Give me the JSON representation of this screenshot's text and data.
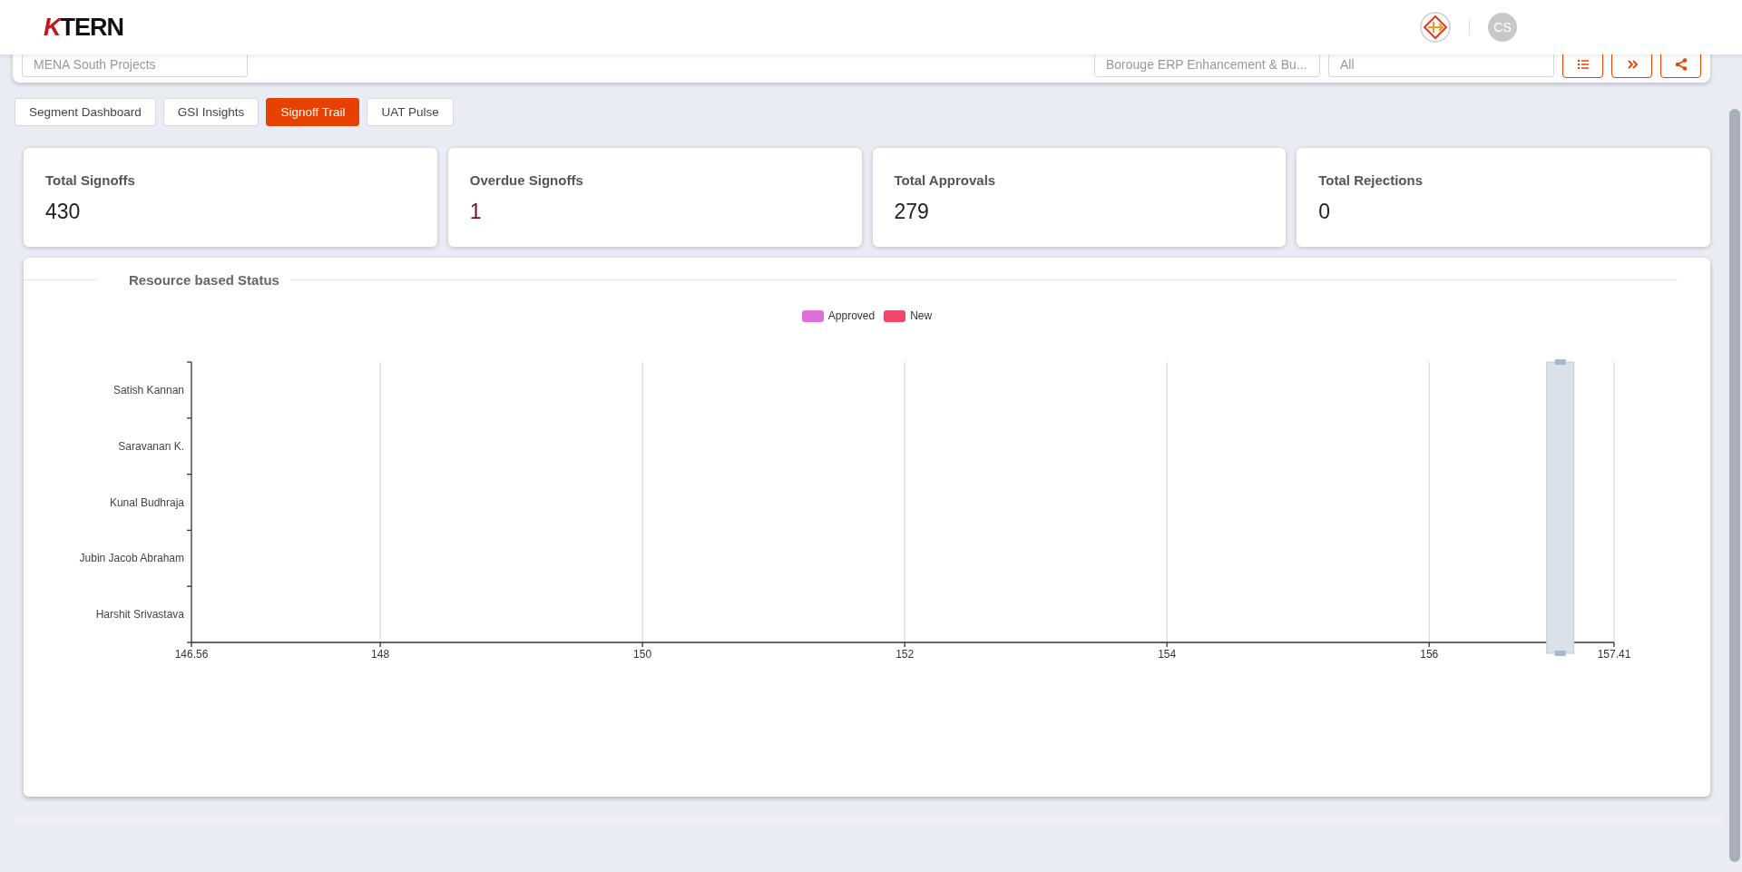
{
  "header": {
    "logo": "KTERN",
    "avatar": "CS"
  },
  "filters": [
    {
      "placeholder": "MENA South Projects"
    },
    {
      "placeholder": "Borouge ERP Enhancement & Bu..."
    },
    {
      "placeholder": "All"
    }
  ],
  "actions": [
    {
      "kind": "list"
    },
    {
      "kind": "expand"
    },
    {
      "kind": "share"
    }
  ],
  "tabs": [
    {
      "label": "Segment Dashboard",
      "selected": false
    },
    {
      "label": "GSI Insights",
      "selected": false
    },
    {
      "label": "Signoff Trail",
      "selected": true
    },
    {
      "label": "UAT Pulse",
      "selected": false
    }
  ],
  "stats": [
    {
      "label": "Total Signoffs",
      "value": "430",
      "alert": false
    },
    {
      "label": "Overdue Signoffs",
      "value": "1",
      "alert": true
    },
    {
      "label": "Total Approvals",
      "value": "279",
      "alert": false
    },
    {
      "label": "Total Rejections",
      "value": "0",
      "alert": false
    }
  ],
  "chart_panel": {
    "title": "Resource based Status",
    "chart_data": {
      "type": "bar",
      "orientation": "horizontal",
      "categories": [
        "Satish Kannan",
        "Saravanan K.",
        "Kunal Budhraja",
        "Jubin Jacob Abraham",
        "Harshit Srivastava"
      ],
      "series": [
        {
          "name": "Approved",
          "color": "#dd6fda",
          "values": [
            null,
            null,
            null,
            null,
            null
          ]
        },
        {
          "name": "New",
          "color": "#f0476b",
          "values": [
            null,
            null,
            null,
            null,
            null
          ]
        }
      ],
      "xlim": [
        146.56,
        157.41
      ],
      "grid": true,
      "xticks": [
        {
          "value": 146.56,
          "label": "146.56"
        },
        {
          "value": 148,
          "label": "148"
        },
        {
          "value": 150,
          "label": "150"
        },
        {
          "value": 152,
          "label": "152"
        },
        {
          "value": 154,
          "label": "154"
        },
        {
          "value": 156,
          "label": "156"
        },
        {
          "value": 157.41,
          "label": "157.41"
        }
      ]
    }
  }
}
